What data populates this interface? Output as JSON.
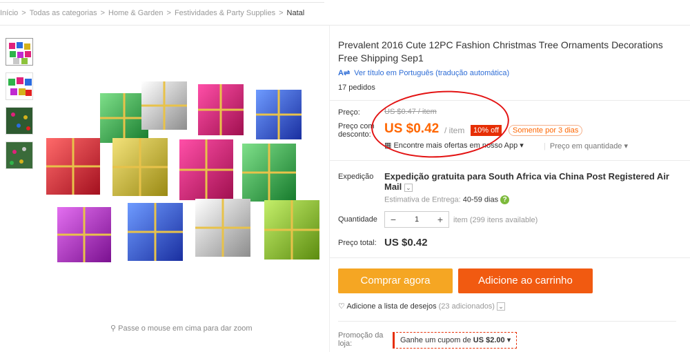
{
  "breadcrumb": {
    "items": [
      "Início",
      "Todas as categorias",
      "Home & Garden",
      "Festividades & Party Supplies",
      "Natal"
    ],
    "separator": ">"
  },
  "image": {
    "zoom_hint": "Passe o mouse em cima para dar zoom"
  },
  "product": {
    "title": "Prevalent 2016 Cute 12PC Fashion Christmas Tree Ornaments Decorations Free Shipping Sep1",
    "translate_link": "Ver título em Português (tradução automática)",
    "orders": "17 pedidos"
  },
  "pricing": {
    "price_label": "Preço:",
    "old_price": "US $0.47 / item",
    "discount_label": "Preço com desconto:",
    "price": "US $0.42",
    "per_unit": "/ item",
    "discount_badge": "10% off",
    "only_days": "Somente por 3 dias",
    "app_offer": "Encontre mais ofertas em nosso App",
    "qty_price": "Preço em quantidade"
  },
  "shipping": {
    "label": "Expedição",
    "text_free": "Expedição gratuita para",
    "destination": "South Africa via China Post Registered Air Mail",
    "eta_label": "Estimativa de Entrega:",
    "eta_value": "40-59 dias"
  },
  "quantity": {
    "label": "Quantidade",
    "minus": "−",
    "value": "1",
    "plus": "+",
    "available": "item (299 itens available)"
  },
  "total": {
    "label": "Preço total:",
    "value": "US $0.42"
  },
  "actions": {
    "buy_now": "Comprar agora",
    "add_to_cart": "Adicione ao carrinho",
    "wishlist": "Adicione a lista de desejos",
    "wishlist_count": "(23 adicionados)"
  },
  "promo": {
    "label": "Promoção da loja:",
    "coupon_prefix": "Ganhe um cupom de",
    "coupon_value": "US $2.00"
  },
  "colors": {
    "orange": "#f60",
    "buy_now": "#f5a623",
    "add_cart": "#f15a11",
    "link": "#2e6dd6",
    "annotation_circle": "#e31313"
  }
}
